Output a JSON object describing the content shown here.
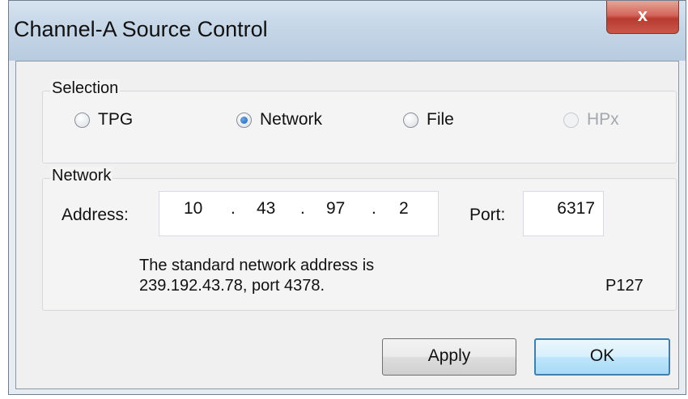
{
  "window": {
    "title": "Channel-A Source Control",
    "close_label": "x"
  },
  "selection": {
    "group_label": "Selection",
    "options": [
      {
        "label": "TPG",
        "checked": false,
        "disabled": false
      },
      {
        "label": "Network",
        "checked": true,
        "disabled": false
      },
      {
        "label": "File",
        "checked": false,
        "disabled": false
      },
      {
        "label": "HPx",
        "checked": false,
        "disabled": true
      }
    ]
  },
  "network": {
    "group_label": "Network",
    "address_label": "Address:",
    "address_octets": [
      "10",
      "43",
      "97",
      "2"
    ],
    "address_separator": ".",
    "port_label": "Port:",
    "port_value": "6317",
    "note_line1": "The standard network address is",
    "note_line2": "239.192.43.78, port 4378.",
    "code": "P127"
  },
  "buttons": {
    "apply_label": "Apply",
    "ok_label": "OK"
  }
}
